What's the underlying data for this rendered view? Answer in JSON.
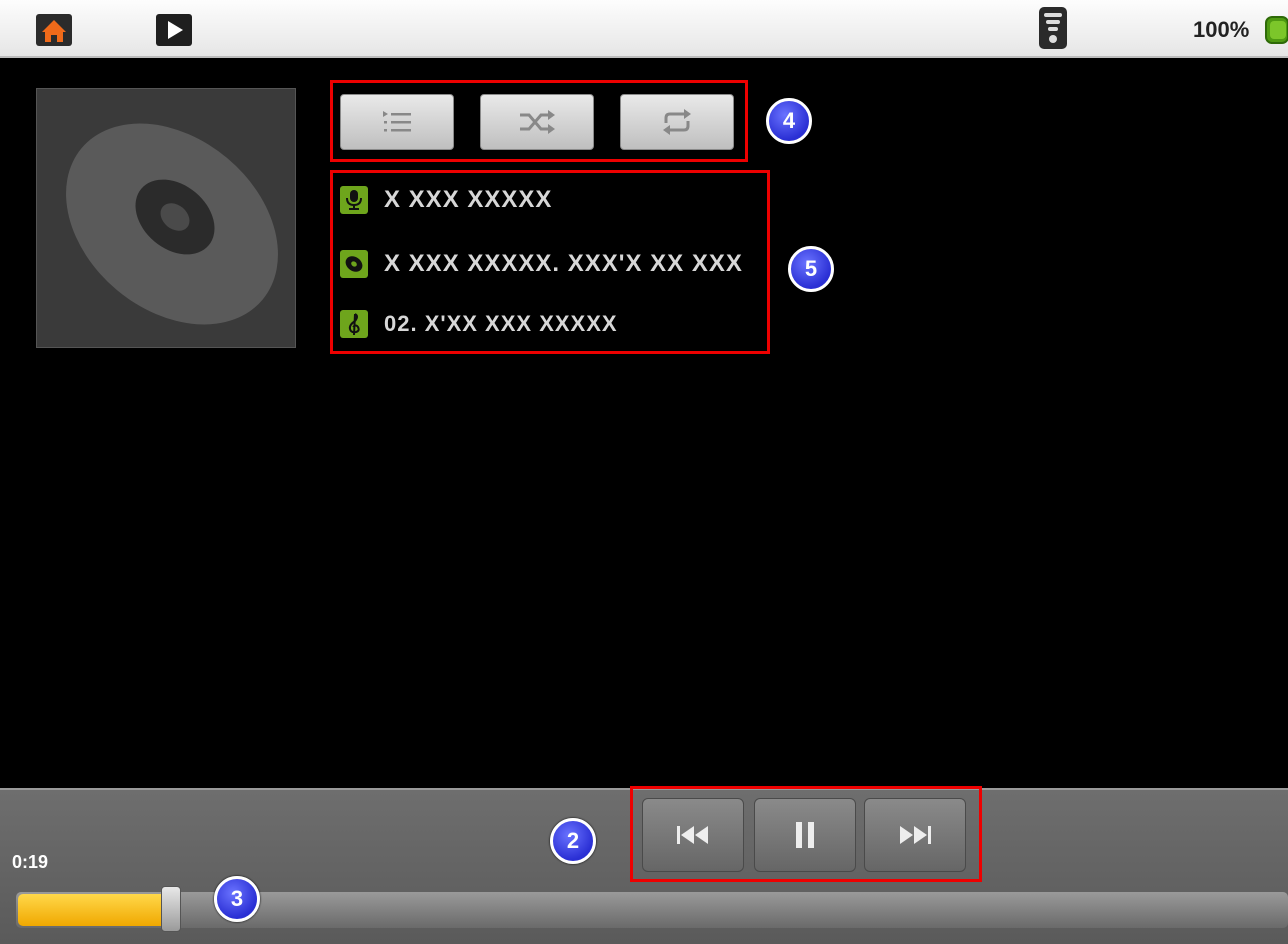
{
  "status_bar": {
    "icons": [
      "home-icon",
      "play-icon",
      "wifi-signal-icon",
      "battery-icon"
    ],
    "battery_text": "100%"
  },
  "mode_buttons": {
    "icons": [
      "playlist-icon",
      "shuffle-icon",
      "repeat-icon"
    ]
  },
  "track_info": {
    "artist": "X XXX XXXXX",
    "album": "X XXX XXXXX. XXX'X XX XXX",
    "track": "02. X'XX XXX XXXXX"
  },
  "callouts": {
    "b2": "2",
    "b3": "3",
    "b4": "4",
    "b5": "5"
  },
  "transport": {
    "icons": [
      "previous-icon",
      "pause-icon",
      "next-icon"
    ]
  },
  "progress": {
    "current_time": "0:19",
    "fraction": 0.113
  },
  "colors": {
    "accent_green": "#6ea51c",
    "progress_fill": "#f5b400",
    "callout_border": "#e00000",
    "callout_badge": "#3b40e0"
  }
}
